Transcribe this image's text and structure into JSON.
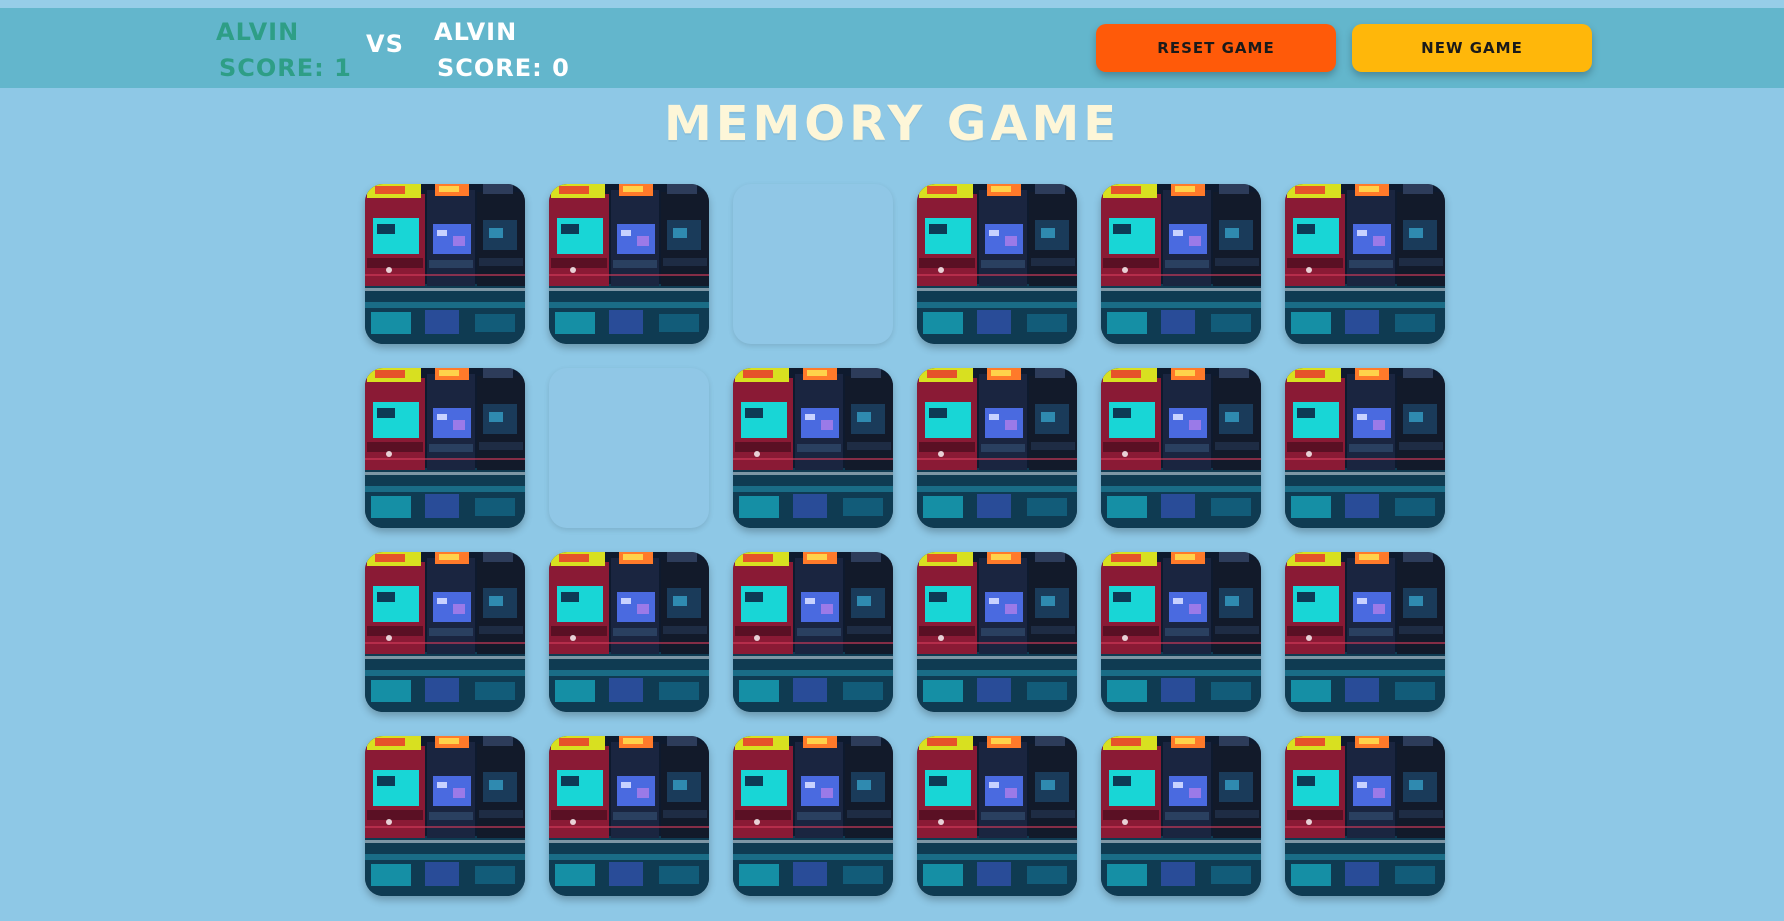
{
  "header": {
    "player1": {
      "name": "ALVIN",
      "score_text": "SCORE: 1"
    },
    "vs": "VS",
    "player2": {
      "name": "ALVIN",
      "score_text": "SCORE: 0"
    },
    "reset_label": "RESET GAME",
    "new_label": "NEW GAME"
  },
  "title": "MEMORY GAME",
  "board": {
    "columns": 6,
    "rows": 4,
    "cards": [
      "face-down",
      "face-down",
      "matched",
      "face-down",
      "face-down",
      "face-down",
      "face-down",
      "matched",
      "face-down",
      "face-down",
      "face-down",
      "face-down",
      "face-down",
      "face-down",
      "face-down",
      "face-down",
      "face-down",
      "face-down",
      "face-down",
      "face-down",
      "face-down",
      "face-down",
      "face-down",
      "face-down"
    ],
    "card_back_icon": "arcade-cabinet-image"
  },
  "colors": {
    "background": "#8ec8e6",
    "header": "#63b6cc",
    "player1": "#2e9e86",
    "player2": "#ffffff",
    "reset_button": "#ff5a09",
    "new_button": "#ffb70a",
    "title": "#fdf6d8"
  }
}
